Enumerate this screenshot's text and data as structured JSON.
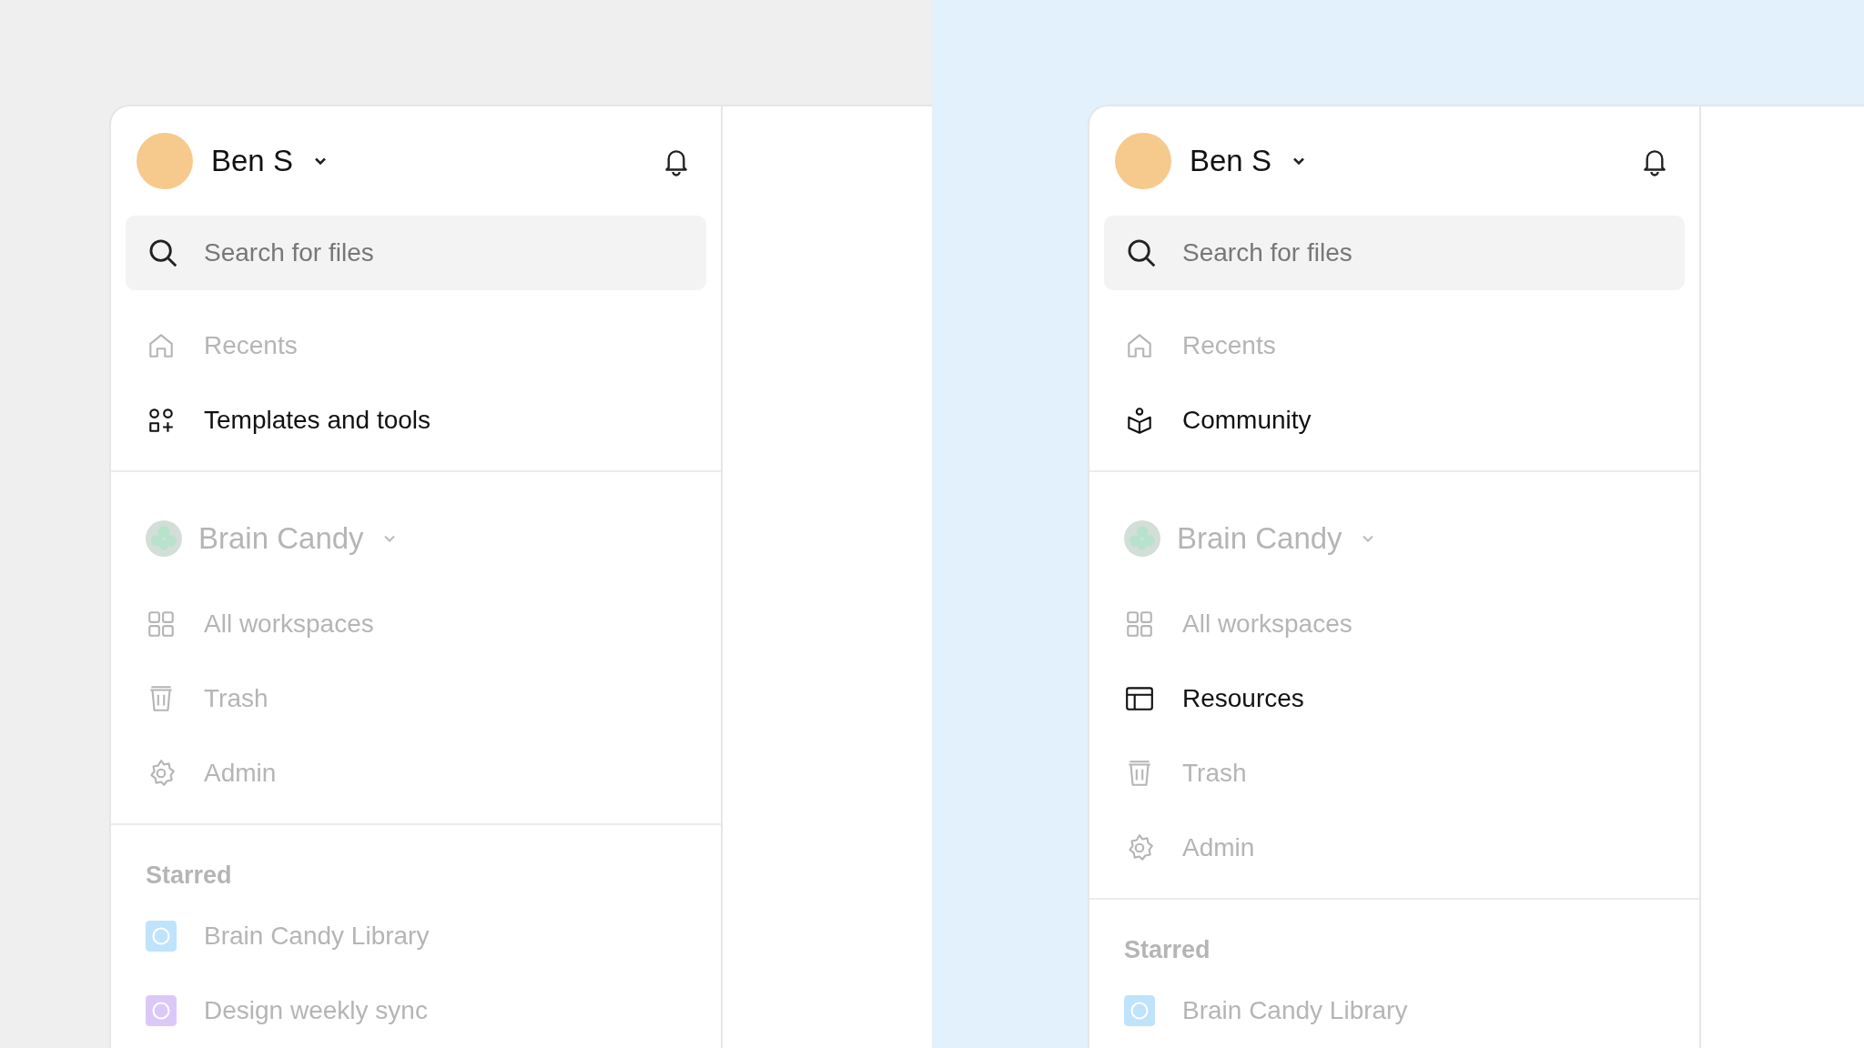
{
  "panels": [
    {
      "user": {
        "name": "Ben S"
      },
      "search": {
        "placeholder": "Search for files"
      },
      "top_items": [
        {
          "label": "Recents",
          "kind": "home",
          "active": false
        },
        {
          "label": "Templates and tools",
          "kind": "shapes",
          "active": true
        }
      ],
      "workspace": {
        "name": "Brain Candy"
      },
      "workspace_items": [
        {
          "label": "All workspaces",
          "kind": "grid",
          "active": false
        },
        {
          "label": "Trash",
          "kind": "trash",
          "active": false
        },
        {
          "label": "Admin",
          "kind": "gear",
          "active": false
        }
      ],
      "starred": {
        "heading": "Starred",
        "items": [
          {
            "label": "Brain Candy Library",
            "color": "#bfe3fb"
          },
          {
            "label": "Design weekly sync",
            "color": "#dcc8f8"
          }
        ]
      }
    },
    {
      "user": {
        "name": "Ben S"
      },
      "search": {
        "placeholder": "Search for files"
      },
      "top_items": [
        {
          "label": "Recents",
          "kind": "home",
          "active": false
        },
        {
          "label": "Community",
          "kind": "community",
          "active": true
        }
      ],
      "workspace": {
        "name": "Brain Candy"
      },
      "workspace_items": [
        {
          "label": "All workspaces",
          "kind": "grid",
          "active": false
        },
        {
          "label": "Resources",
          "kind": "layout",
          "active": true
        },
        {
          "label": "Trash",
          "kind": "trash",
          "active": false
        },
        {
          "label": "Admin",
          "kind": "gear",
          "active": false
        }
      ],
      "starred": {
        "heading": "Starred",
        "items": [
          {
            "label": "Brain Candy Library",
            "color": "#bfe3fb"
          }
        ]
      }
    }
  ]
}
